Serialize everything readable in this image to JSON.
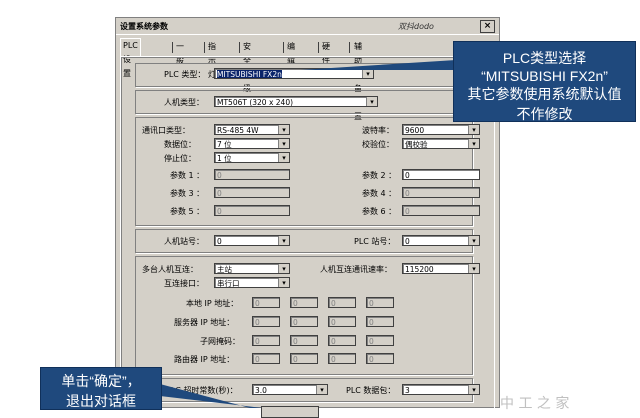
{
  "window": {
    "title": "设置系统参数",
    "signature": "双抖dodo",
    "close": "×"
  },
  "tabs": [
    {
      "label": "PLC 设置"
    },
    {
      "label": "一般"
    },
    {
      "label": "指示灯"
    },
    {
      "label": "安全等级"
    },
    {
      "label": "编辑器"
    },
    {
      "label": "硬件"
    },
    {
      "label": "辅助设备设置"
    }
  ],
  "plc": {
    "type_label": "PLC 类型：",
    "type_value": "MITSUBISHI FX2n"
  },
  "hmi": {
    "type_label": "人机类型：",
    "type_value": "MT506T (320 x 240)"
  },
  "comm": {
    "port_type_label": "通讯口类型：",
    "port_type_value": "RS-485 4W",
    "databits_label": "数据位：",
    "databits_value": "7 位",
    "stopbits_label": "停止位：",
    "stopbits_value": "1 位",
    "baud_label": "波特率：",
    "baud_value": "9600",
    "parity_label": "校验位：",
    "parity_value": "偶校验",
    "p1_label": "参数 1 ：",
    "p1_value": "0",
    "p2_label": "参数 2 ：",
    "p2_value": "0",
    "p3_label": "参数 3 ：",
    "p3_value": "0",
    "p4_label": "参数 4 ：",
    "p4_value": "0",
    "p5_label": "参数 5 ：",
    "p5_value": "0",
    "p6_label": "参数 6 ：",
    "p6_value": "0"
  },
  "station": {
    "hmi_label": "人机站号：",
    "hmi_value": "0",
    "plc_label": "PLC 站号：",
    "plc_value": "0"
  },
  "multi": {
    "link_label": "多台人机互连：",
    "link_value": "主站",
    "rate_label": "人机互连通讯速率：",
    "rate_value": "115200",
    "port_label": "互连接口：",
    "port_value": "串行口",
    "local_ip_label": "本地 IP 地址：",
    "server_ip_label": "服务器 IP 地址：",
    "mask_label": "子网掩码：",
    "router_ip_label": "路由器 IP 地址：",
    "ip_octet": "0"
  },
  "timeout": {
    "label": "PLC 超时常数(秒)：",
    "value": "3.0",
    "packet_label": "PLC 数据包：",
    "packet_value": "3"
  },
  "callout_plc": {
    "line1": "PLC类型选择",
    "line2": "“MITSUBISHI   FX2n”",
    "line3": "其它参数使用系统默认值",
    "line4": "不作修改"
  },
  "callout_ok": {
    "line1": "单击“确定”，",
    "line2": "退出对话框"
  },
  "watermark": "中 工 之 家",
  "colors": {
    "callout_bg": "#1f497d",
    "dialog_bg": "#d4d0c8"
  }
}
